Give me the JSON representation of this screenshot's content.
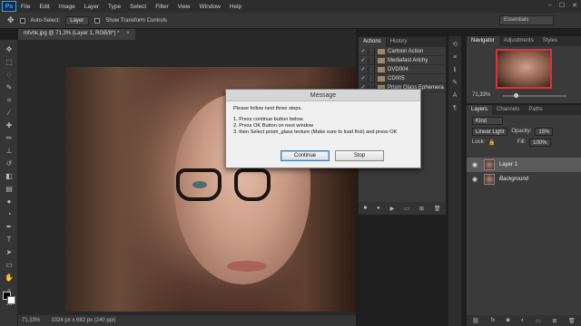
{
  "app": {
    "logo": "Ps"
  },
  "menu": [
    "File",
    "Edit",
    "Image",
    "Layer",
    "Type",
    "Select",
    "Filter",
    "View",
    "Window",
    "Help"
  ],
  "window_controls": [
    "–",
    "☐",
    "✕"
  ],
  "options_bar": {
    "auto_select_label": "Auto-Select:",
    "auto_select_value": "Layer",
    "transform_label": "Show Transform Controls",
    "workspace": "Essentials"
  },
  "document_tab": {
    "title": "mfvhk.jpg @ 71,3% (Layer 1, RGB/8*) *",
    "close": "×"
  },
  "status_bar": {
    "zoom": "71,33%",
    "doc_info": "1024 px x 682 px (240 ppi)"
  },
  "dialog": {
    "title": "Message",
    "intro": "Please follow next three steps.",
    "steps": [
      "1. Press continue button below.",
      "2. Press OK Button on next window",
      "3. then Select prism_glass texture (Make sure to load first) and press OK"
    ],
    "continue_label": "Continue",
    "stop_label": "Stop"
  },
  "actions_panel": {
    "tabs": [
      "Actions",
      "History"
    ],
    "items": [
      {
        "check": "✓",
        "label": "Cartoon Action"
      },
      {
        "check": "✓",
        "label": "Mediafast Artchy"
      },
      {
        "check": "✓",
        "label": "DVD004"
      },
      {
        "check": "✓",
        "label": "CD005"
      },
      {
        "check": "✓",
        "label": "Prism Glass Ephemera"
      }
    ]
  },
  "navigator": {
    "tabs": [
      "Navigator",
      "Adjustments",
      "Styles"
    ],
    "zoom": "71,33%"
  },
  "layers_panel": {
    "tabs": [
      "Layers",
      "Channels",
      "Paths"
    ],
    "kind_label": "Kind",
    "blend_mode": "Linear Light",
    "opacity_label": "Opacity:",
    "opacity_value": "15%",
    "lock_label": "Lock:",
    "fill_label": "Fill:",
    "fill_value": "100%",
    "layers": [
      {
        "name": "Layer 1",
        "selected": true
      },
      {
        "name": "Background",
        "selected": false
      }
    ]
  }
}
